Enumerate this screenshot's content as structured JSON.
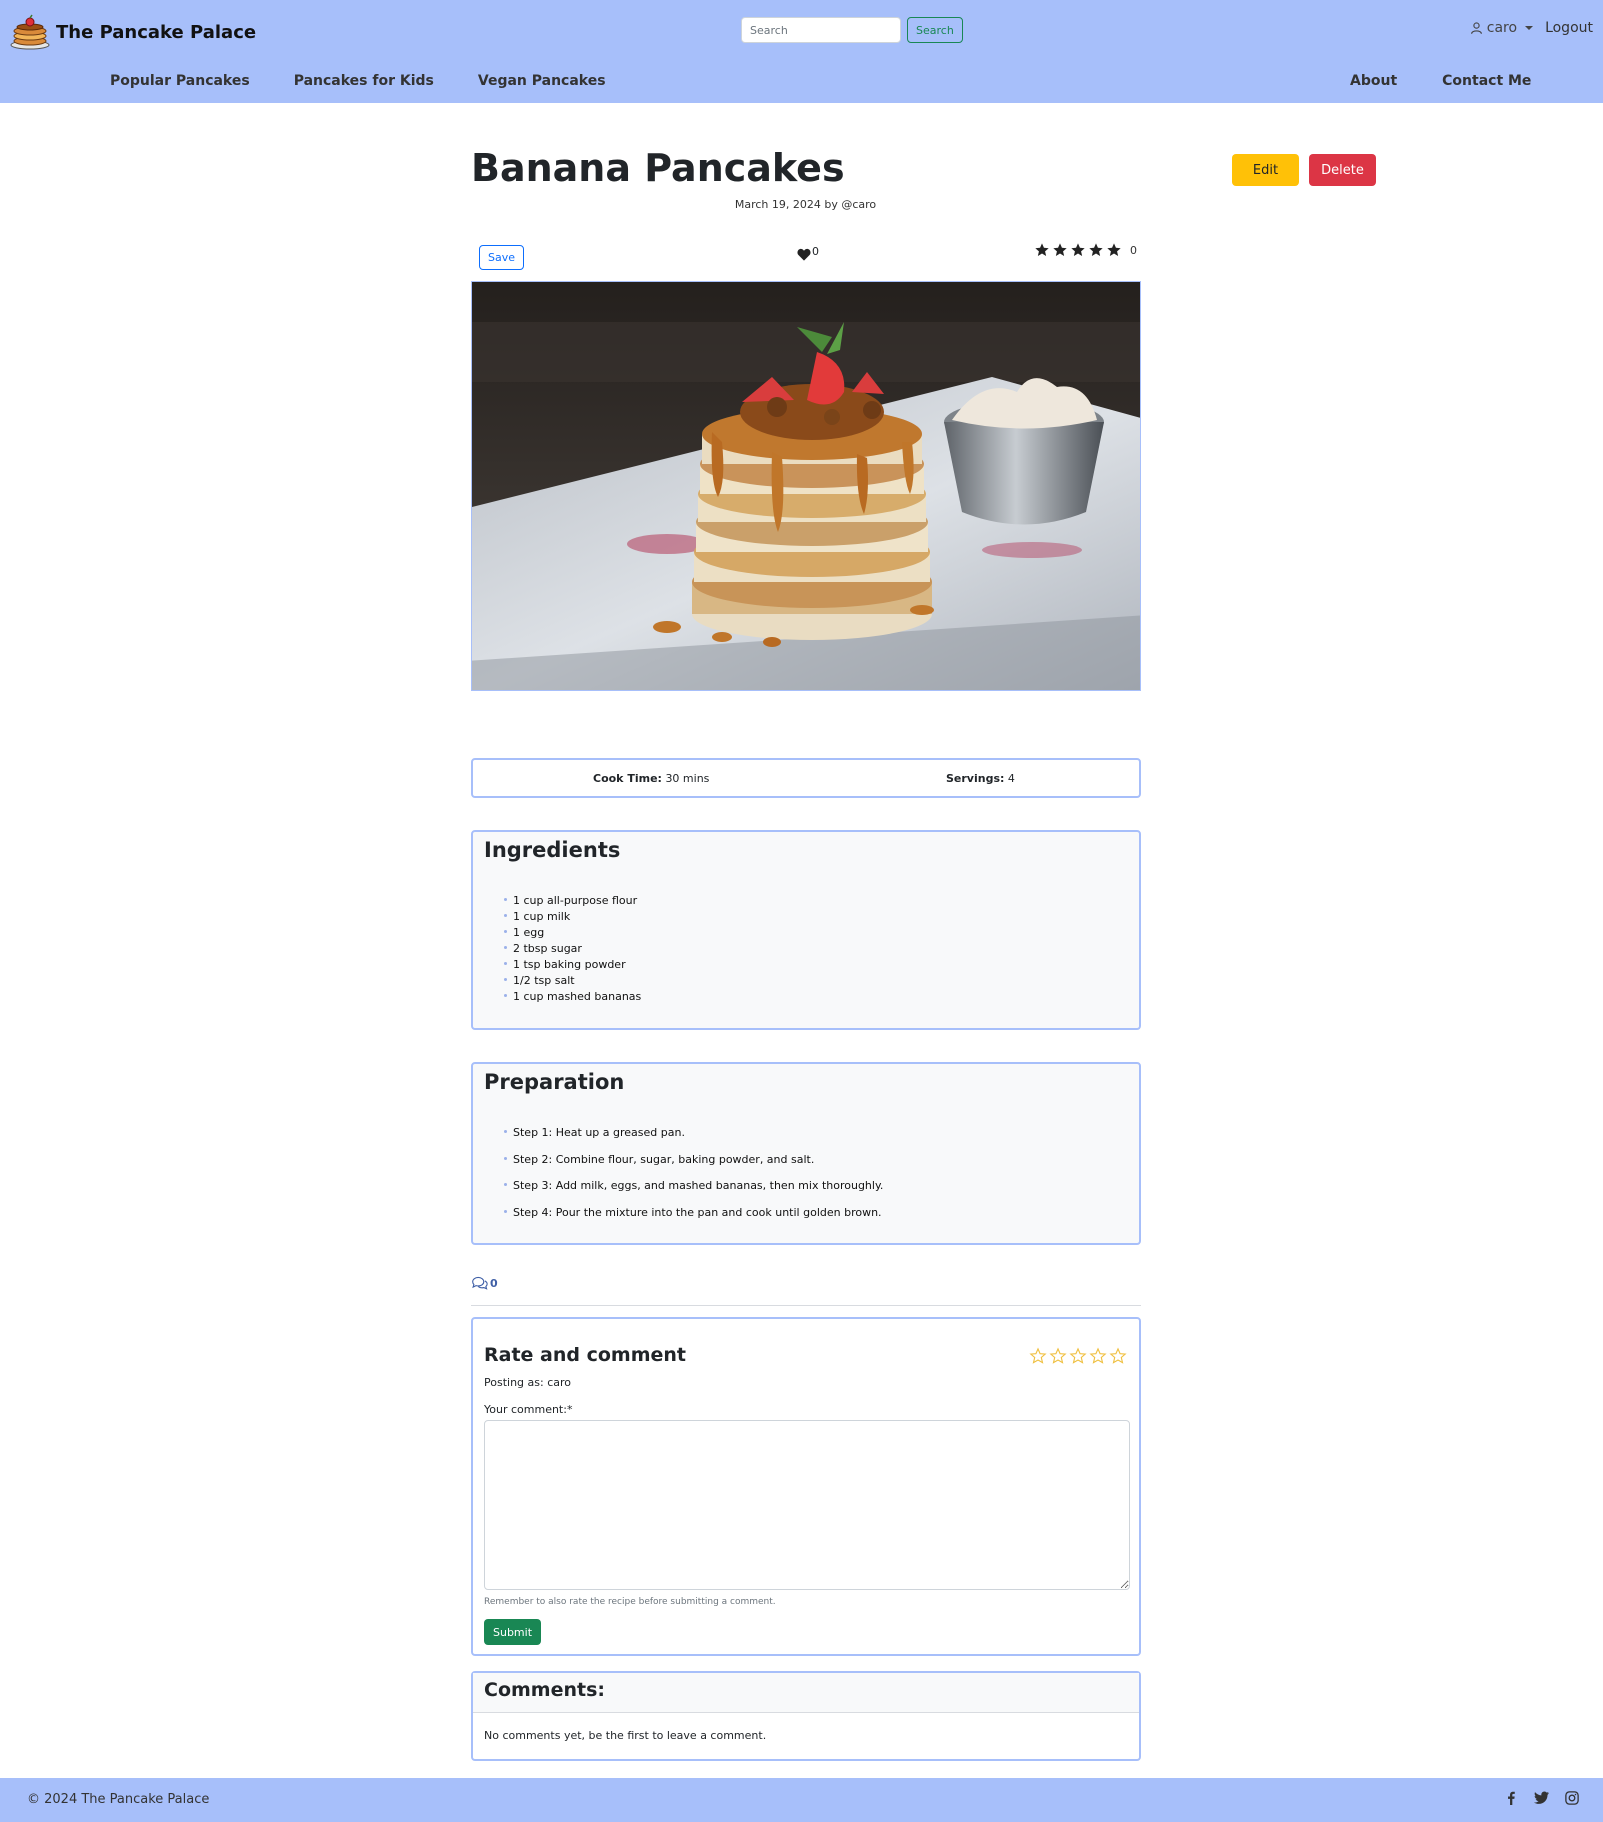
{
  "site": {
    "name": "The Pancake Palace"
  },
  "search": {
    "placeholder": "Search",
    "button": "Search"
  },
  "user": {
    "name": "caro",
    "logout": "Logout"
  },
  "nav": {
    "left": [
      "Popular Pancakes",
      "Pancakes for Kids",
      "Vegan Pancakes"
    ],
    "right": [
      "About",
      "Contact Me"
    ]
  },
  "recipe": {
    "title": "Banana Pancakes",
    "byline": "March 19, 2024 by @caro",
    "edit": "Edit",
    "delete": "Delete",
    "save": "Save",
    "likes": "0",
    "rating_count": "0",
    "rating_value": 5,
    "cook_time_label": "Cook Time:",
    "cook_time": "30 mins",
    "servings_label": "Servings:",
    "servings": "4"
  },
  "ingredients": {
    "title": "Ingredients",
    "items": [
      "1 cup all-purpose flour",
      "1 cup milk",
      "1 egg",
      "2 tbsp sugar",
      "1 tsp baking powder",
      "1/2 tsp salt",
      "1 cup mashed bananas"
    ]
  },
  "preparation": {
    "title": "Preparation",
    "steps": [
      "Step 1: Heat up a greased pan.",
      "Step 2: Combine flour, sugar, baking powder, and salt.",
      "Step 3: Add milk, eggs, and mashed bananas, then mix thoroughly.",
      "Step 4: Pour the mixture into the pan and cook until golden brown."
    ]
  },
  "comments_meta": {
    "count": "0"
  },
  "rate_form": {
    "title": "Rate and comment",
    "posting_as": "Posting as: caro",
    "label": "Your comment:*",
    "help": "Remember to also rate the recipe before submitting a comment.",
    "submit": "Submit"
  },
  "comments": {
    "title": "Comments:",
    "empty": "No comments yet, be the first to leave a comment."
  },
  "footer": {
    "copyright": "© 2024 The Pancake Palace"
  },
  "colors": {
    "nav_bg": "#a7bffa",
    "edit": "#ffc107",
    "delete": "#dc3545",
    "submit": "#198754",
    "star_outline": "#f0c040"
  },
  "icons": [
    "pancake-logo",
    "user-icon",
    "heart-icon",
    "star-icon",
    "comment-icon",
    "facebook-icon",
    "twitter-icon",
    "instagram-icon"
  ]
}
